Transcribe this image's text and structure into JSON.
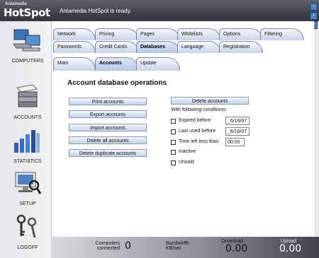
{
  "app": {
    "brand_small": "Antamedia",
    "brand_big": "HotSpot",
    "status": "Antamedia HotSpot is ready."
  },
  "sidebar": {
    "items": [
      {
        "label": "COMPUTERS",
        "icon": "computers-icon"
      },
      {
        "label": "ACCOUNTS",
        "icon": "accounts-icon"
      },
      {
        "label": "STATISTICS",
        "icon": "statistics-icon"
      },
      {
        "label": "SETUP",
        "icon": "setup-icon"
      },
      {
        "label": "LOGOFF",
        "icon": "logoff-icon"
      }
    ]
  },
  "tabs": {
    "row1": [
      "Network",
      "Pricing",
      "Pages",
      "Whitelists",
      "Options",
      "Filtering"
    ],
    "row2": [
      "Passwords",
      "Credit Cards",
      "Databases",
      "Language",
      "Registration"
    ],
    "row3": [
      "Main",
      "Accounts",
      "Update"
    ]
  },
  "content": {
    "title": "Account database operations",
    "buttons": [
      "Print accounts",
      "Export accounts",
      "Import accounts",
      "Delete all accounts",
      "Delete duplicate accounts"
    ],
    "delete_btn": "Delete accounts",
    "conditions_label": "With following conditions:",
    "expired_label": "Expired before",
    "expired_value": "_6/16/07",
    "lastused_label": "Last used before",
    "lastused_value": "_6/16/07",
    "timeleft_label": "Time left less than",
    "timeleft_value": "00:05",
    "inactive_label": "Inactive",
    "unsold_label": "Unsold"
  },
  "footer": {
    "computers_label_1": "Computers",
    "computers_label_2": "connected",
    "computers_value": "0",
    "bandwidth_label_1": "Bandwidth",
    "bandwidth_label_2": "KB/sec",
    "download_label": "Download",
    "download_value": "0.00",
    "upload_label": "Upload",
    "upload_value": "0.00"
  },
  "colors": {
    "tab_active": "#b5c7e6",
    "tab": "#c8d3e6",
    "titlebar": "#3f434a"
  }
}
